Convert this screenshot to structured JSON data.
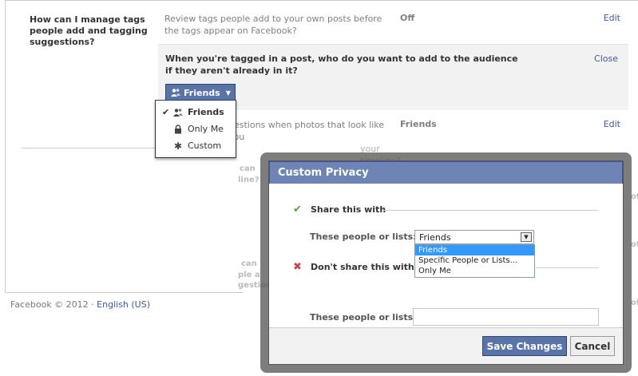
{
  "settings": {
    "section_title": "How can I manage tags people add and tagging suggestions?",
    "review_row": {
      "description": "Review tags people add to your own posts before the tags appear on Facebook?",
      "status": "Off",
      "edit_label": "Edit"
    },
    "audience_row": {
      "question": "When you're tagged in a post, who do you want to add to the audience if they aren't already in it?",
      "close_label": "Close",
      "button_label": "Friends",
      "button_icon": "friends-icon"
    },
    "suggest_row": {
      "description_l1": "gestions when photos that look like you",
      "description_l2": "your timeline?",
      "status": "Friends",
      "edit_label": "Edit"
    },
    "ghost_fragments": {
      "a1": "can",
      "a2": "line?",
      "b1": "can",
      "b2": "ple a",
      "b3": "gestions",
      "r1": "of",
      "r2": "of",
      "r3": "of"
    }
  },
  "privacy_menu": {
    "items": [
      {
        "label": "Friends",
        "icon": "friends-icon",
        "selected": true
      },
      {
        "label": "Only Me",
        "icon": "lock-icon",
        "selected": false
      },
      {
        "label": "Custom",
        "icon": "gear-icon",
        "selected": false
      }
    ],
    "checkmark": "✔"
  },
  "footer": {
    "copyright": "Facebook © 2012 ·",
    "language": "English (US)"
  },
  "dialog": {
    "title": "Custom Privacy",
    "share_header": "Share this with",
    "share_label": "These people or lists:",
    "share_selected": "Friends",
    "share_options": [
      "Friends",
      "Specific People or Lists...",
      "Only Me"
    ],
    "dont_share_header": "Don't share this with",
    "dont_share_label": "These people or lists:",
    "dont_share_value": "",
    "save_label": "Save Changes",
    "cancel_label": "Cancel"
  },
  "colors": {
    "brand_blue": "#3b5998",
    "button_blue": "#5b74a8",
    "titlebar_blue": "#6d84b4",
    "highlight": "#3399ff",
    "check_green": "#5fa03a",
    "cross_red": "#c44"
  }
}
